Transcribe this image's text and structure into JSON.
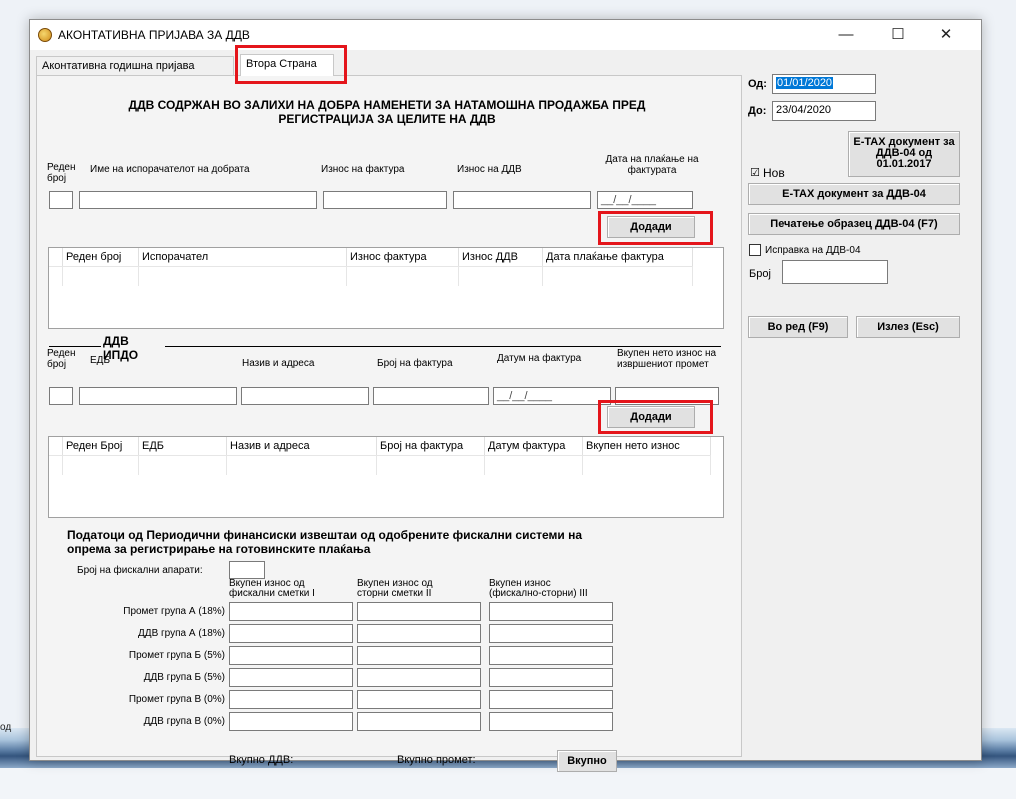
{
  "background": {
    "left_text": "од"
  },
  "window": {
    "title": "АКОНТАТИВНА ПРИЈАВА ЗА ДДВ",
    "minimize": "—",
    "maximize": "☐",
    "close": "✕"
  },
  "tabs": [
    "Аконтативна годишна пријава",
    "Втора Страна"
  ],
  "section1": {
    "title_line1": "ДДВ СОДРЖАН ВО ЗАЛИХИ НА ДОБРА НАМЕНЕТИ ЗА НАТАМОШНА ПРОДАЖБА ПРЕД",
    "title_line2": "РЕГИСТРАЦИЈА ЗА ЦЕЛИТЕ НА ДДВ",
    "col_redenbroj": "Реден број",
    "col_ime": "Име на испорачателот на добрата",
    "col_iznos_faktura": "Износ на фактура",
    "col_iznos_ddv": "Износ на ДДВ",
    "col_data": "Дата на плаќање на фактурата",
    "date_placeholder": "__/__/____",
    "add_button": "Додади",
    "grid_headers": [
      "Реден број",
      "Испорачател",
      "Износ фактура",
      "Износ ДДВ",
      "Дата плаќање фактура"
    ]
  },
  "section2": {
    "title": "ДДВ ИПДО",
    "col_redenbroj": "Реден број",
    "col_edb": "ЕДБ",
    "col_naziv": "Назив и адреса",
    "col_broj_faktura": "Број на фактура",
    "col_datum": "Датум на фактура",
    "col_vkupen": "Вкупен нето износ на извршениот промет",
    "date_placeholder": "__/__/____",
    "add_button": "Додади",
    "grid_headers": [
      "Реден Број",
      "ЕДБ",
      "Назив и адреса",
      "Број на фактура",
      "Датум фактура",
      "Вкупен нето износ"
    ]
  },
  "section3": {
    "title_line1": "Податоци од Периодични финансиски извештаи од одобрените  фискални системи на",
    "title_line2": "опрема за регистрирање на готовинските плаќања",
    "broj_aparati": "Број на фискални апарати:",
    "col1": "Вкупен износ од фискални сметки I",
    "col2": "Вкупен износ од сторни сметки II",
    "col3": "Вкупен износ (фискално-сторни) III",
    "rows": [
      "Промет група А (18%)",
      "ДДВ група А (18%)",
      "Промет група Б (5%)",
      "ДДВ група Б (5%)",
      "Промет група В (0%)",
      "ДДВ група В (0%)"
    ],
    "vkupno_ddv": "Вкупно ДДВ:",
    "vkupno_promet": "Вкупно промет:",
    "vkupno_button": "Вкупно"
  },
  "right": {
    "od_label": "Од:",
    "od_value": "01/01/2020",
    "do_label": "До:",
    "do_value": "23/04/2020",
    "etax_2017_btn": "E-TAX документ за ДДВ-04 од 01.01.2017",
    "nov_label": "Нов",
    "nov_checked": "☑",
    "etax_btn": "E-TAX документ за ДДВ-04",
    "print_btn": "Печатење образец ДДВ-04 (F7)",
    "ispravka_label": "Исправка на ДДВ-04",
    "broj_label": "Број",
    "ok_btn": "Во ред (F9)",
    "exit_btn": "Излез (Esc)"
  },
  "colors": {
    "highlight": "#e4151b",
    "selection": "#0078d7"
  }
}
